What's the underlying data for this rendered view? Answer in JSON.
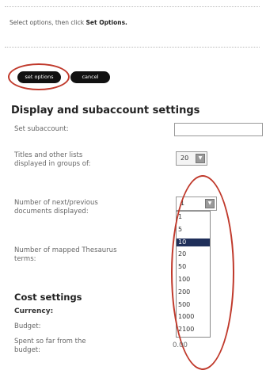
{
  "instructions": {
    "prefix": "Select options, then click ",
    "bold": "Set Options."
  },
  "buttons": {
    "set": "set options",
    "cancel": "cancel"
  },
  "display": {
    "title": "Display and subaccount settings",
    "subaccount_label": "Set subaccount:",
    "subaccount_value": "",
    "titles_label_1": "Titles and other lists",
    "titles_label_2": "displayed in groups of:",
    "titles_value": "20",
    "nextprev_label_1": "Number of next/previous",
    "nextprev_label_2": "documents displayed:",
    "nextprev_value": "1",
    "nextprev_options": [
      "1",
      "5",
      "10",
      "20",
      "50",
      "100",
      "200",
      "500",
      "1000",
      "2100"
    ],
    "nextprev_highlight_index": 2,
    "thesaurus_label_1": "Number of mapped Thesaurus",
    "thesaurus_label_2": "terms:"
  },
  "cost": {
    "title": "Cost settings",
    "currency_label": "Currency:",
    "budget_label": "Budget:",
    "spent_label_1": "Spent so far from the",
    "spent_label_2": "budget:",
    "spent_value": "0.00"
  },
  "icons": {
    "dropdown_arrow": "chevron-down-icon"
  },
  "colors": {
    "button_bg": "#111111",
    "annotation_ring": "#c0392b",
    "selected_option": "#1f2f5a"
  }
}
